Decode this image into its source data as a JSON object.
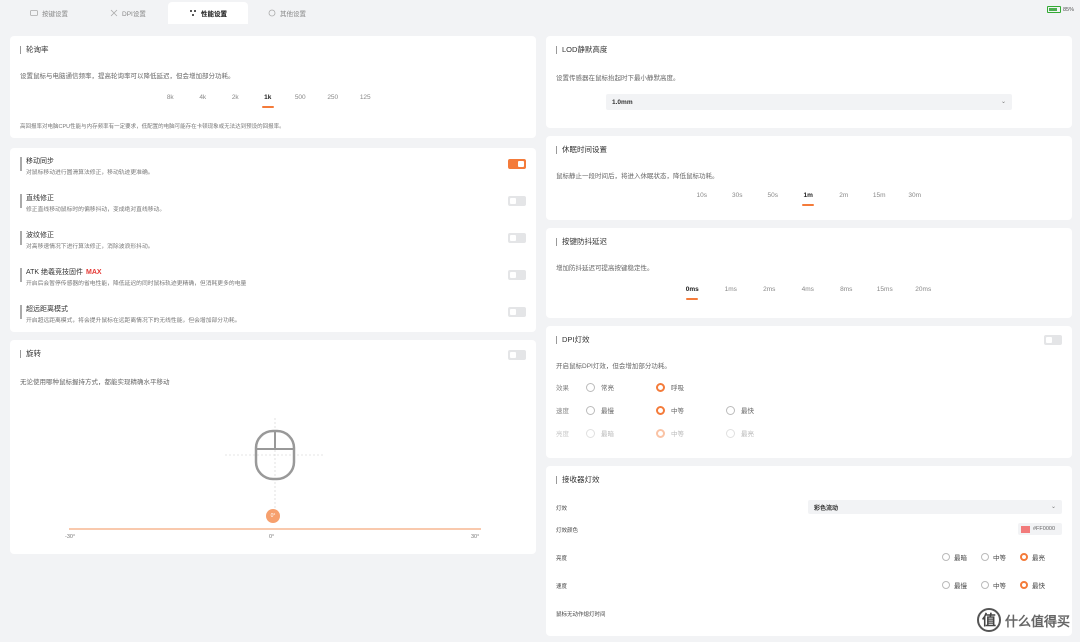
{
  "tabs": [
    {
      "label": "按键设置",
      "icon": "keyboard-icon"
    },
    {
      "label": "DPI设置",
      "icon": "crosshair-icon"
    },
    {
      "label": "性能设置",
      "icon": "performance-icon"
    },
    {
      "label": "其他设置",
      "icon": "settings-icon"
    }
  ],
  "battery": {
    "percent": "85%",
    "level": 0.85
  },
  "polling": {
    "title": "轮询率",
    "desc": "设置鼠标与电脑通信频率，提高轮询率可以降低延迟，但会增加部分功耗。",
    "options": [
      "8k",
      "4k",
      "2k",
      "1k",
      "500",
      "250",
      "125"
    ],
    "selected": "1k",
    "note": "高回报率对电脑CPU性能与内存频率有一定要求，低配置的电脑可能存在卡顿现象或无法达到预设的回报率。"
  },
  "features": [
    {
      "title": "移动同步",
      "desc": "对鼠标移动进行圆滑算法修正，移动轨迹更准确。",
      "on": true
    },
    {
      "title": "直线修正",
      "desc": "修正直线移动鼠标时的偏移抖动，变成绝对直线移动。",
      "on": false
    },
    {
      "title": "波纹修正",
      "desc": "对高移速情况下进行算法修正，消除波浪形抖动。",
      "on": false
    },
    {
      "title": "ATK 绝羲竞技固件",
      "badge": "MAX",
      "desc": "开启后会暂停传感器的省电性能，降低延迟的同时鼠标轨迹更精确，但消耗更多的电量",
      "on": false
    },
    {
      "title": "超远距离模式",
      "desc": "开启超远距离模式，将会提升鼠标在远距离情况下的无线性能，但会增加部分功耗。",
      "on": false
    }
  ],
  "rotation": {
    "title": "旋转",
    "desc": "无论使用哪种鼠标握持方式，都能实现精确水平移动",
    "value": "0°",
    "min": "-30°",
    "mid": "0°",
    "max": "30°",
    "on": false
  },
  "lod": {
    "title": "LOD静默高度",
    "desc": "设置传感器在鼠标抬起时下最小静默高度。",
    "value": "1.0mm"
  },
  "sleep": {
    "title": "休眠时间设置",
    "desc": "鼠标静止一段时间后，将进入休眠状态，降低鼠标功耗。",
    "options": [
      "10s",
      "30s",
      "50s",
      "1m",
      "2m",
      "15m",
      "30m"
    ],
    "selected": "1m"
  },
  "debounce": {
    "title": "按键防抖延迟",
    "desc": "增加防抖延迟可提高按键稳定性。",
    "options": [
      "0ms",
      "1ms",
      "2ms",
      "4ms",
      "8ms",
      "15ms",
      "20ms"
    ],
    "selected": "0ms"
  },
  "dpi_light": {
    "title": "DPI灯效",
    "desc": "开启鼠标DPI灯效，但会增加部分功耗。",
    "on": false,
    "rows": [
      {
        "label": "效果",
        "options": [
          "常亮",
          "呼吸"
        ],
        "selected": 1,
        "faded": false
      },
      {
        "label": "速度",
        "options": [
          "最慢",
          "中等",
          "最快"
        ],
        "selected": 1,
        "faded": false
      },
      {
        "label": "亮度",
        "options": [
          "最暗",
          "中等",
          "最亮"
        ],
        "selected": 1,
        "faded": true
      }
    ]
  },
  "receiver_light": {
    "title": "接收器灯效",
    "effect_label": "灯效",
    "effect_value": "彩色流动",
    "color_label": "灯效颜色",
    "color_value": "#FF0000",
    "brightness_label": "亮度",
    "brightness_options": [
      "最暗",
      "中等",
      "最亮"
    ],
    "brightness_selected": 2,
    "speed_label": "速度",
    "speed_options": [
      "最慢",
      "中等",
      "最快"
    ],
    "speed_selected": 2,
    "idle_label": "鼠标无动作熄灯时间"
  },
  "watermark": {
    "logo": "值",
    "text": "什么值得买"
  },
  "colors": {
    "accent": "#f47b3a",
    "badge": "#e53935",
    "swatch": "#f27b7b"
  }
}
